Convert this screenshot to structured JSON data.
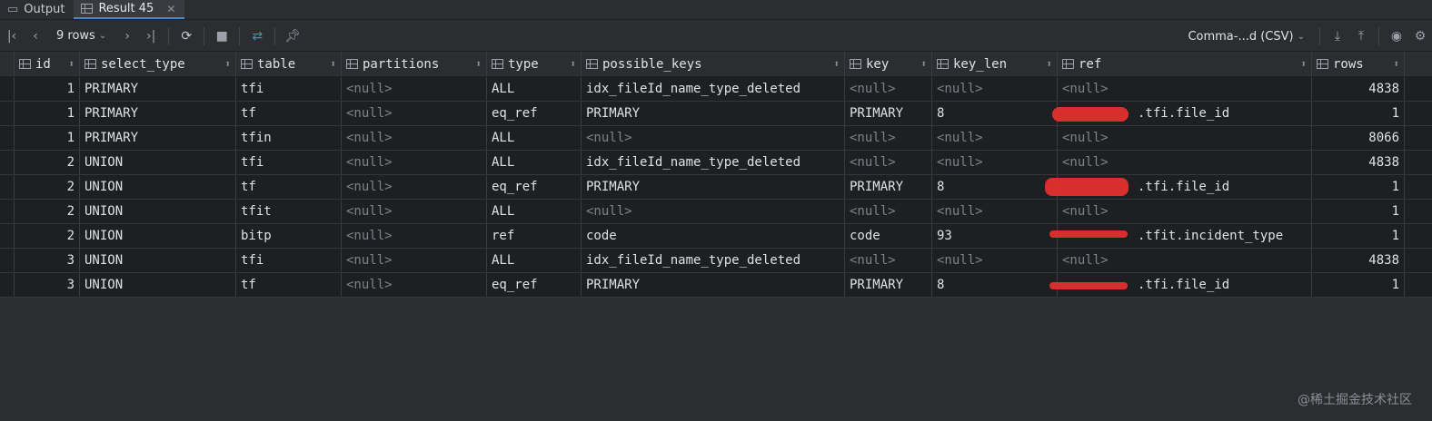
{
  "tabs": [
    {
      "label": "Output",
      "icon": "output-icon"
    },
    {
      "label": "Result 45",
      "icon": "table-icon"
    }
  ],
  "toolbar": {
    "rows_label": "9 rows",
    "export_format": "Comma-...d (CSV)"
  },
  "columns": [
    {
      "name": "id",
      "numeric": true
    },
    {
      "name": "select_type"
    },
    {
      "name": "table"
    },
    {
      "name": "partitions"
    },
    {
      "name": "type"
    },
    {
      "name": "possible_keys"
    },
    {
      "name": "key"
    },
    {
      "name": "key_len"
    },
    {
      "name": "ref"
    },
    {
      "name": "rows",
      "numeric": true
    }
  ],
  "rows": [
    [
      "1",
      "PRIMARY",
      "tfi",
      "<null>",
      "ALL",
      "idx_fileId_name_type_deleted",
      "<null>",
      "<null>",
      "<null>",
      "4838"
    ],
    [
      "1",
      "PRIMARY",
      "tf",
      "<null>",
      "eq_ref",
      "PRIMARY",
      "PRIMARY",
      "8",
      ".tfi.file_id",
      "1"
    ],
    [
      "1",
      "PRIMARY",
      "tfin",
      "<null>",
      "ALL",
      "<null>",
      "<null>",
      "<null>",
      "<null>",
      "8066"
    ],
    [
      "2",
      "UNION",
      "tfi",
      "<null>",
      "ALL",
      "idx_fileId_name_type_deleted",
      "<null>",
      "<null>",
      "<null>",
      "4838"
    ],
    [
      "2",
      "UNION",
      "tf",
      "<null>",
      "eq_ref",
      "PRIMARY",
      "PRIMARY",
      "8",
      ".tfi.file_id",
      "1"
    ],
    [
      "2",
      "UNION",
      "tfit",
      "<null>",
      "ALL",
      "<null>",
      "<null>",
      "<null>",
      "<null>",
      "1"
    ],
    [
      "2",
      "UNION",
      "bitp",
      "<null>",
      "ref",
      "code",
      "code",
      "93",
      ".tfit.incident_type",
      "1"
    ],
    [
      "3",
      "UNION",
      "tfi",
      "<null>",
      "ALL",
      "idx_fileId_name_type_deleted",
      "<null>",
      "<null>",
      "<null>",
      "4838"
    ],
    [
      "3",
      "UNION",
      "tf",
      "<null>",
      "eq_ref",
      "PRIMARY",
      "PRIMARY",
      "8",
      ".tfi.file_id",
      "1"
    ]
  ],
  "watermark": "@稀土掘金技术社区",
  "colors": {
    "accent": "#4a88c7",
    "redaction": "#e3302f"
  }
}
